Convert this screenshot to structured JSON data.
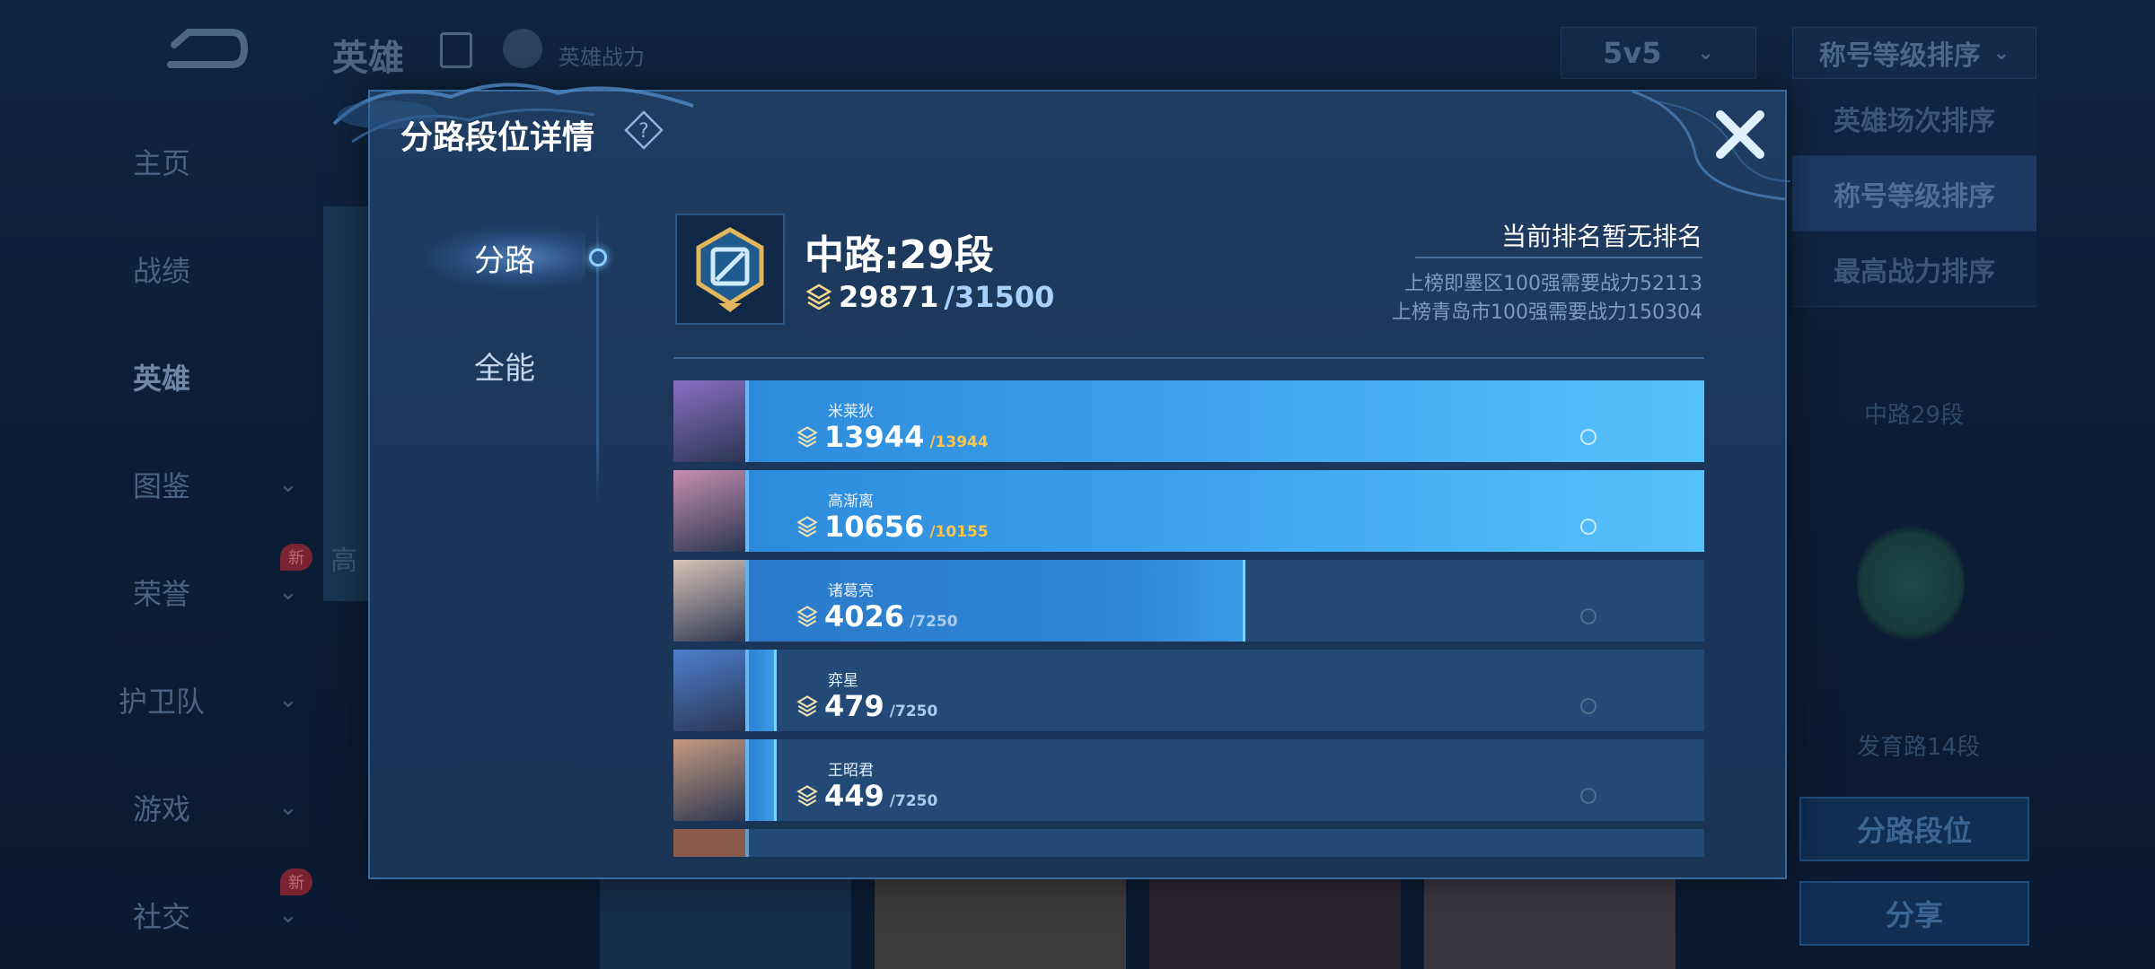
{
  "background": {
    "page_title": "英雄",
    "sub_label": "英雄战力",
    "mode_select": "5v5",
    "sort_select": "称号等级排序",
    "sort_options": [
      "英雄场次排序",
      "称号等级排序",
      "最高战力排序"
    ],
    "nav_items": [
      "主页",
      "战绩",
      "英雄",
      "图鉴",
      "荣誉",
      "护卫队",
      "游戏",
      "社交"
    ],
    "new_badge": "新",
    "right_lane_1": "中路29段",
    "right_lane_2": "发育路14段",
    "right_btn_lane": "分路段位",
    "right_btn_share": "分享",
    "strip_text": "高"
  },
  "modal": {
    "title": "分路段位详情",
    "help_icon": "question-icon",
    "close_icon": "close-icon",
    "tabs": [
      "分路",
      "全能"
    ],
    "active_tab": "分路",
    "lane": {
      "title": "中路:29段",
      "power_current": "29871",
      "power_max": "/31500"
    },
    "rank": {
      "status": "当前排名暂无排名",
      "req_district": "上榜即墨区100强需要战力52113",
      "req_city": "上榜青岛市100强需要战力150304"
    },
    "heroes": [
      {
        "name": "米莱狄",
        "power": "13944",
        "required": "/13944",
        "fill": 1.0,
        "color": "#8a6fc4"
      },
      {
        "name": "高渐离",
        "power": "10656",
        "required": "/10155",
        "fill": 1.0,
        "color": "#c68fb2"
      },
      {
        "name": "诸葛亮",
        "power": "4026",
        "required": "/7250",
        "fill": 0.555,
        "color": "#d8c3b8"
      },
      {
        "name": "弈星",
        "power": "479",
        "required": "/7250",
        "fill": 0.066,
        "color": "#4d7fcf"
      },
      {
        "name": "王昭君",
        "power": "449",
        "required": "/7250",
        "fill": 0.062,
        "color": "#c59a80"
      }
    ]
  }
}
